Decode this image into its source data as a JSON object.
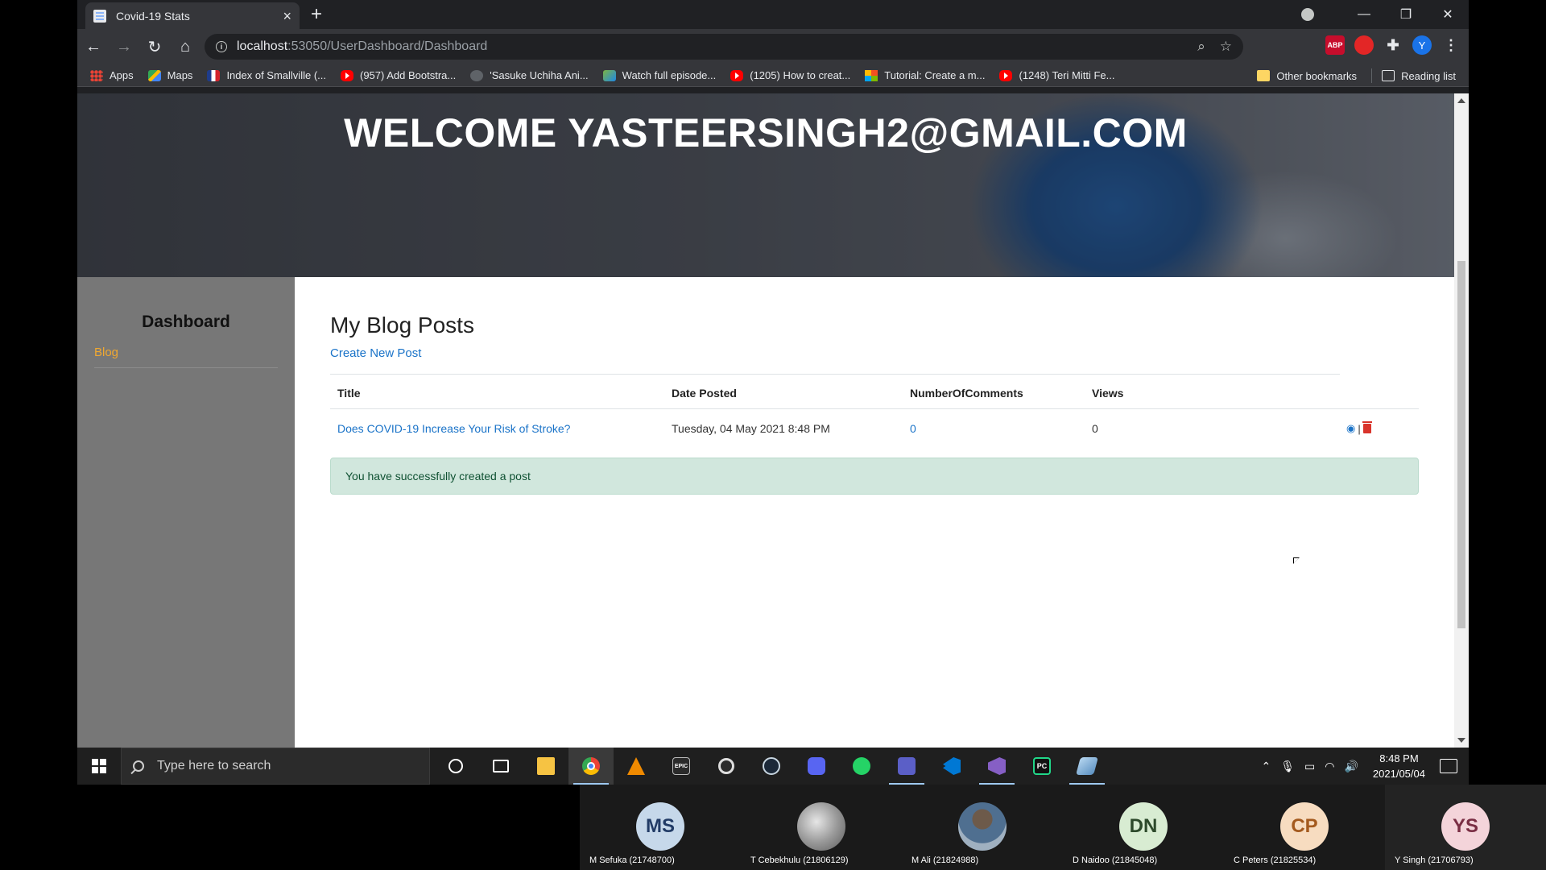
{
  "browser": {
    "tab_title": "Covid-19 Stats",
    "url_host": "localhost",
    "url_rest": ":53050/UserDashboard/Dashboard",
    "profile_initial": "Y",
    "abp_label": "ABP"
  },
  "bookmarks": {
    "items": [
      {
        "label": "Apps",
        "icon": "apps-icon"
      },
      {
        "label": "Maps",
        "icon": "maps-icon"
      },
      {
        "label": "Index of Smallville (...",
        "icon": "flag-icon"
      },
      {
        "label": "(957) Add Bootstra...",
        "icon": "youtube-icon"
      },
      {
        "label": "'Sasuke Uchiha Ani...",
        "icon": "site-icon"
      },
      {
        "label": "Watch full episode...",
        "icon": "image-icon"
      },
      {
        "label": "(1205) How to creat...",
        "icon": "youtube-icon"
      },
      {
        "label": "Tutorial: Create a m...",
        "icon": "microsoft-icon"
      },
      {
        "label": "(1248) Teri Mitti Fe...",
        "icon": "youtube-icon"
      }
    ],
    "other": "Other bookmarks",
    "reading_list": "Reading list"
  },
  "page": {
    "welcome": "WELCOME YASTEERSINGH2@GMAIL.COM",
    "sidebar": {
      "title": "Dashboard",
      "link": "Blog"
    },
    "main": {
      "title": "My Blog Posts",
      "create_link": "Create New Post",
      "columns": [
        "Title",
        "Date Posted",
        "NumberOfComments",
        "Views"
      ],
      "rows": [
        {
          "title": "Does COVID-19 Increase Your Risk of Stroke?",
          "date": "Tuesday, 04 May 2021 8:48 PM",
          "comments": "0",
          "views": "0"
        }
      ],
      "alert": "You have successfully created a post"
    }
  },
  "taskbar": {
    "search_placeholder": "Type here to search",
    "apps": [
      "cortana-icon",
      "task-view-icon",
      "file-explorer-icon",
      "chrome-icon",
      "vlc-icon",
      "epic-games-icon",
      "ubisoft-icon",
      "steam-icon",
      "discord-icon",
      "whatsapp-icon",
      "teams-icon",
      "vscode-icon",
      "visual-studio-icon",
      "pycharm-icon",
      "misc-app-icon"
    ],
    "epic_label": "EPIC",
    "pycharm_label": "PC",
    "time": "8:48 PM",
    "date": "2021/05/04"
  },
  "participants": [
    {
      "initials": "MS",
      "name": "M Sefuka (21748700)"
    },
    {
      "initials": "",
      "name": "T Cebekhulu (21806129)"
    },
    {
      "initials": "",
      "name": "M Ali (21824988)"
    },
    {
      "initials": "DN",
      "name": "D Naidoo (21845048)"
    },
    {
      "initials": "CP",
      "name": "C Peters (21825534)"
    },
    {
      "initials": "YS",
      "name": "Y Singh (21706793)"
    }
  ],
  "colors": {
    "link": "#1a73c8",
    "sidebar_link": "#f0a830",
    "sidebar_bg": "#777777",
    "alert_bg": "#d1e7dd",
    "alert_text": "#0f5132"
  }
}
